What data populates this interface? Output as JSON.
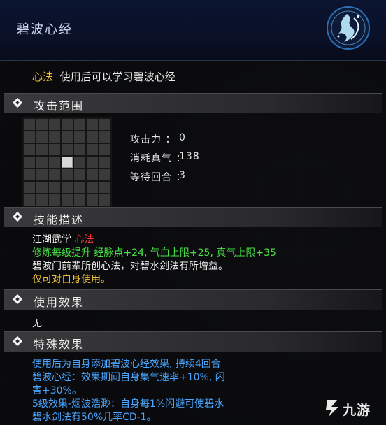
{
  "header": {
    "title": "碧波心经"
  },
  "item_desc": {
    "tag": "心法",
    "text": "使用后可以学习碧波心经"
  },
  "sections": {
    "range": "攻击范围",
    "skill": "技能描述",
    "use_effect": "使用效果",
    "special": "特殊效果"
  },
  "stats": [
    {
      "label": "攻击力 ：",
      "value": "0"
    },
    {
      "label": "消耗真气 ：",
      "value": "138"
    },
    {
      "label": "等待回合 ：",
      "value": "3"
    }
  ],
  "skill_desc": {
    "school_prefix": "江湖武学 ",
    "school_tag": "心法",
    "growth": "修炼每级提升 经脉点+24, 气血上限+25, 真气上限+35",
    "lore": "碧波门前辈所创心法，对碧水剑法有所增益。",
    "target": "仅可对自身使用。"
  },
  "use_effect": {
    "text": "无"
  },
  "special_effect": {
    "lines": [
      "使用后为自身添加碧波心经效果, 持续4回合",
      "碧波心经：效果期间自身集气速率+10%, 闪",
      "害+30%。",
      "5级效果-烟波浩渺：自身每1%闪避可使碧水",
      "碧水剑法有50%几率CD-1。"
    ]
  },
  "watermark": {
    "text": "九游"
  },
  "colors": {
    "yellow": "#f2c23a",
    "red": "#ff3b3b",
    "green": "#46e246",
    "blue": "#4aa6ff"
  },
  "icons": [
    "dancer-emblem-icon",
    "diamond-bullet-icon",
    "jiuyou-logo-icon"
  ],
  "range_grid": {
    "rows": 7,
    "cols": 7,
    "active_cells": [
      [
        3,
        3
      ]
    ]
  }
}
